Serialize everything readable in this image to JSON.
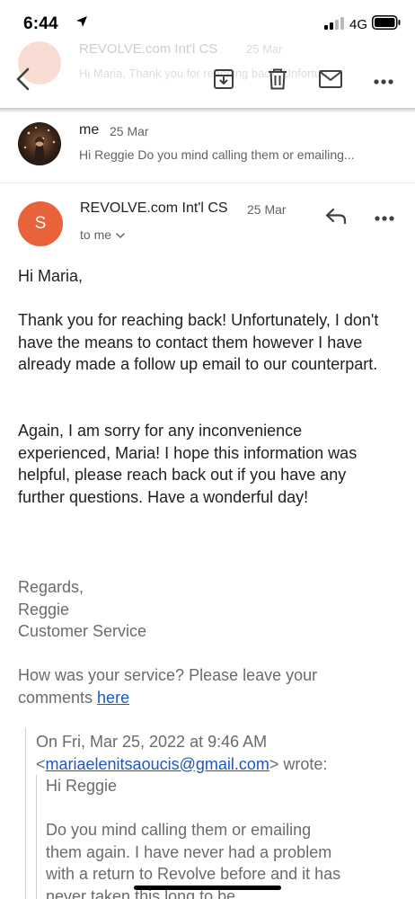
{
  "status_bar": {
    "time": "6:44",
    "network": "4G"
  },
  "ghost_message": {
    "sender": "REVOLVE.com Int'l CS",
    "date": "25 Mar",
    "snippet": "Hi Maria, Thank you for reaching back! Unfortun..."
  },
  "toolbar": {
    "icons": [
      "back-arrow-icon",
      "archive-icon",
      "trash-icon",
      "mail-icon",
      "more-icon"
    ]
  },
  "collapsed_message": {
    "sender": "me",
    "date": "25 Mar",
    "snippet": "Hi Reggie Do you mind calling them or emailing..."
  },
  "message": {
    "avatar_letter": "S",
    "avatar_color": "#e8623a",
    "sender": "REVOLVE.com Int'l CS",
    "date": "25 Mar",
    "recipient": "to me",
    "greeting": "Hi Maria,",
    "paragraph1": "Thank you for reaching back! Unfortunately, I don't have the means to contact them however I have already made a follow up email to our counterpart.",
    "paragraph2": "Again, I am sorry for any inconvenience experienced, Maria! I hope this information was helpful, please reach back out if you have any further questions. Have a wonderful day!",
    "signoff": "Regards,",
    "signature_name": "Reggie",
    "signature_title": "Customer Service",
    "feedback_text": "How was your service? Please leave your comments",
    "feedback_link": "here",
    "quote_header_1": "On Fri, Mar 25, 2022 at 9:46 AM",
    "quote_email": "mariaelenitsaoucis@gmail.com",
    "quote_header_2": "> wrote:",
    "quote_greeting": "Hi Reggie",
    "quote_line1": "Do you mind calling them or emailing",
    "quote_line2": "them again. I have never had a problem",
    "quote_line3": "with a return to Revolve before and it has",
    "quote_line4": "never taken this long to be"
  },
  "colors": {
    "link": "#1a57c8",
    "accent_avatar": "#e8623a"
  }
}
